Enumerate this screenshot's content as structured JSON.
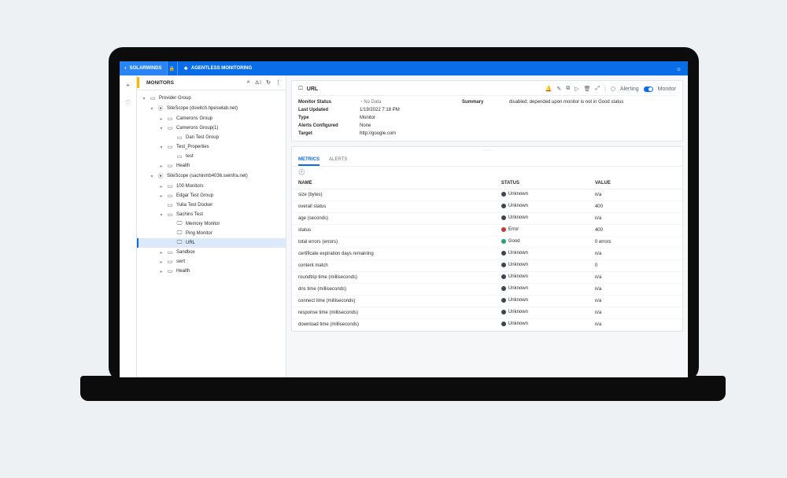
{
  "topbar": {
    "brand": "SOLARWINDS",
    "breadcrumb": "AGENTLESS MONITORING"
  },
  "panel": {
    "title": "MONITORS"
  },
  "tree": [
    {
      "depth": 0,
      "caret": "▾",
      "icon": "▭",
      "label": "Provider Group"
    },
    {
      "depth": 1,
      "caret": "▾",
      "icon": "⦿",
      "label": "SiteScope (dswitch.hpeswlab.net)"
    },
    {
      "depth": 2,
      "caret": "▸",
      "icon": "▭",
      "label": "Camerons Group"
    },
    {
      "depth": 2,
      "caret": "▾",
      "icon": "▭",
      "label": "Camerons Group(1)"
    },
    {
      "depth": 3,
      "caret": " ",
      "icon": "▭",
      "label": "Dan Test Group"
    },
    {
      "depth": 2,
      "caret": "▾",
      "icon": "▭",
      "label": "Test_Properties"
    },
    {
      "depth": 3,
      "caret": " ",
      "icon": "▭",
      "label": "test"
    },
    {
      "depth": 2,
      "caret": "▸",
      "icon": "▭",
      "label": "Health"
    },
    {
      "depth": 1,
      "caret": "▾",
      "icon": "⦿",
      "label": "SiteScope (sachinmb4036.swinfra.net)"
    },
    {
      "depth": 2,
      "caret": "▸",
      "icon": "▭",
      "label": "100 Monitors"
    },
    {
      "depth": 2,
      "caret": "▸",
      "icon": "▭",
      "label": "Edgar Test Group"
    },
    {
      "depth": 2,
      "caret": " ",
      "icon": "▭",
      "label": "Yulia Test Docker"
    },
    {
      "depth": 2,
      "caret": "▾",
      "icon": "▭",
      "label": "Sachins Test"
    },
    {
      "depth": 3,
      "caret": " ",
      "icon": "🖵",
      "label": "Memory Monitor"
    },
    {
      "depth": 3,
      "caret": " ",
      "icon": "🖵",
      "label": "Ping Monitor"
    },
    {
      "depth": 3,
      "caret": " ",
      "icon": "🖵",
      "label": "URL",
      "selected": true
    },
    {
      "depth": 2,
      "caret": "▸",
      "icon": "▭",
      "label": "Sandbox"
    },
    {
      "depth": 2,
      "caret": "▸",
      "icon": "▭",
      "label": "swrt"
    },
    {
      "depth": 2,
      "caret": "▸",
      "icon": "▭",
      "label": "Health"
    }
  ],
  "detail": {
    "title": "URL",
    "alerting_label": "Alerting",
    "monitor_label": "Monitor",
    "rows": {
      "monitor_status_k": "Monitor Status",
      "monitor_status_v": "No Data",
      "summary_k": "Summary",
      "summary_v": "disabled; depended upon monitor is not in Good status",
      "last_updated_k": "Last Updated",
      "last_updated_v": "1/19/2022 7:18 PM",
      "type_k": "Type",
      "type_v": "Monitor",
      "alerts_k": "Alerts Configured",
      "alerts_v": "None",
      "target_k": "Target",
      "target_v": "http://google.com"
    }
  },
  "tabs": {
    "metrics": "METRICS",
    "alerts": "ALERTS"
  },
  "metrics_head": {
    "name": "NAME",
    "status": "STATUS",
    "value": "VALUE"
  },
  "metrics": [
    {
      "name": "size (bytes)",
      "status": "Unknown",
      "cls": "unknown",
      "value": "n/a"
    },
    {
      "name": "overall status",
      "status": "Unknown",
      "cls": "unknown",
      "value": "400"
    },
    {
      "name": "age (seconds)",
      "status": "Unknown",
      "cls": "unknown",
      "value": "n/a"
    },
    {
      "name": "status",
      "status": "Error",
      "cls": "error",
      "value": "400"
    },
    {
      "name": "total errors (errors)",
      "status": "Good",
      "cls": "good",
      "value": "0 errors"
    },
    {
      "name": "certificate expiration days remaining",
      "status": "Unknown",
      "cls": "unknown",
      "value": "n/a"
    },
    {
      "name": "content match",
      "status": "Unknown",
      "cls": "unknown",
      "value": "0"
    },
    {
      "name": "roundtrip time (milliseconds)",
      "status": "Unknown",
      "cls": "unknown",
      "value": "n/a"
    },
    {
      "name": "dns time (milliseconds)",
      "status": "Unknown",
      "cls": "unknown",
      "value": "n/a"
    },
    {
      "name": "connect time (milliseconds)",
      "status": "Unknown",
      "cls": "unknown",
      "value": "n/a"
    },
    {
      "name": "response time (milliseconds)",
      "status": "Unknown",
      "cls": "unknown",
      "value": "n/a"
    },
    {
      "name": "download time (milliseconds)",
      "status": "Unknown",
      "cls": "unknown",
      "value": "n/a"
    }
  ]
}
